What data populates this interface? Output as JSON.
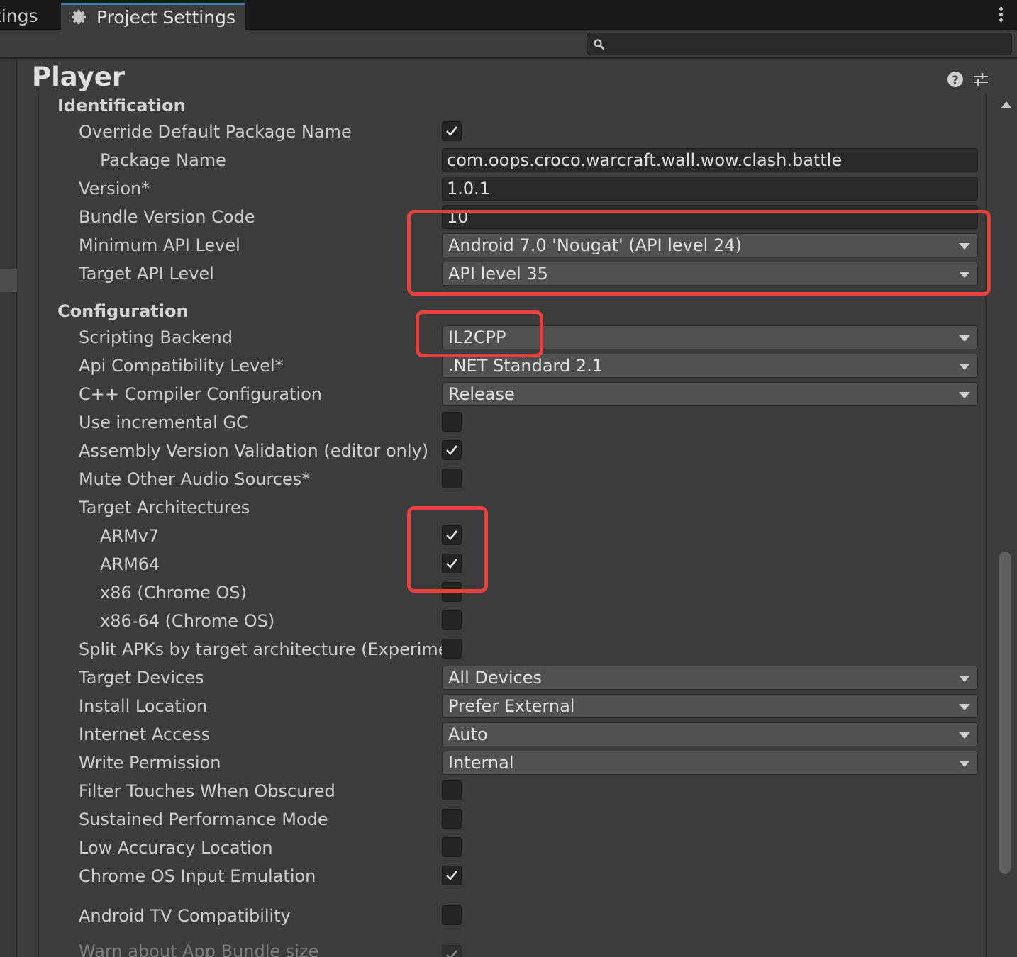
{
  "tabs": {
    "prev_label": "tings",
    "active_label": "Project Settings"
  },
  "search": {
    "placeholder": ""
  },
  "panel": {
    "title": "Player"
  },
  "identification": {
    "title": "Identification",
    "override_package_name": {
      "label": "Override Default Package Name",
      "checked": true
    },
    "package_name": {
      "label": "Package Name",
      "value": "com.oops.croco.warcraft.wall.wow.clash.battle"
    },
    "version": {
      "label": "Version*",
      "value": "1.0.1"
    },
    "bundle_version_code": {
      "label": "Bundle Version Code",
      "value": "10"
    },
    "minimum_api_level": {
      "label": "Minimum API Level",
      "value": "Android 7.0 'Nougat' (API level 24)"
    },
    "target_api_level": {
      "label": "Target API Level",
      "value": "API level 35"
    }
  },
  "configuration": {
    "title": "Configuration",
    "scripting_backend": {
      "label": "Scripting Backend",
      "value": "IL2CPP"
    },
    "api_compatibility": {
      "label": "Api Compatibility Level*",
      "value": ".NET Standard 2.1"
    },
    "cpp_compiler_config": {
      "label": "C++ Compiler Configuration",
      "value": "Release"
    },
    "incremental_gc": {
      "label": "Use incremental GC",
      "checked": false
    },
    "assembly_version_validation": {
      "label": "Assembly Version Validation (editor only)",
      "checked": true
    },
    "mute_other_audio": {
      "label": "Mute Other Audio Sources*",
      "checked": false
    },
    "target_architectures": {
      "label": "Target Architectures"
    },
    "armv7": {
      "label": "ARMv7",
      "checked": true
    },
    "arm64": {
      "label": "ARM64",
      "checked": true
    },
    "x86": {
      "label": "x86 (Chrome OS)",
      "checked": false
    },
    "x86_64": {
      "label": "x86-64 (Chrome OS)",
      "checked": false
    },
    "split_apks": {
      "label": "Split APKs by target architecture (Experimental)",
      "checked": false
    },
    "target_devices": {
      "label": "Target Devices",
      "value": "All Devices"
    },
    "install_location": {
      "label": "Install Location",
      "value": "Prefer External"
    },
    "internet_access": {
      "label": "Internet Access",
      "value": "Auto"
    },
    "write_permission": {
      "label": "Write Permission",
      "value": "Internal"
    },
    "filter_touches": {
      "label": "Filter Touches When Obscured",
      "checked": false
    },
    "sustained_performance": {
      "label": "Sustained Performance Mode",
      "checked": false
    },
    "low_accuracy_location": {
      "label": "Low Accuracy Location",
      "checked": false
    },
    "chrome_os_input": {
      "label": "Chrome OS Input Emulation",
      "checked": true
    },
    "android_tv": {
      "label": "Android TV Compatibility",
      "checked": false
    },
    "warn_app_bundle_size": {
      "label": "Warn about App Bundle size",
      "checked": true
    }
  },
  "colors": {
    "highlight": "#e8403f",
    "tab_accent": "#3a79bb",
    "background": "#3c3c3c"
  }
}
